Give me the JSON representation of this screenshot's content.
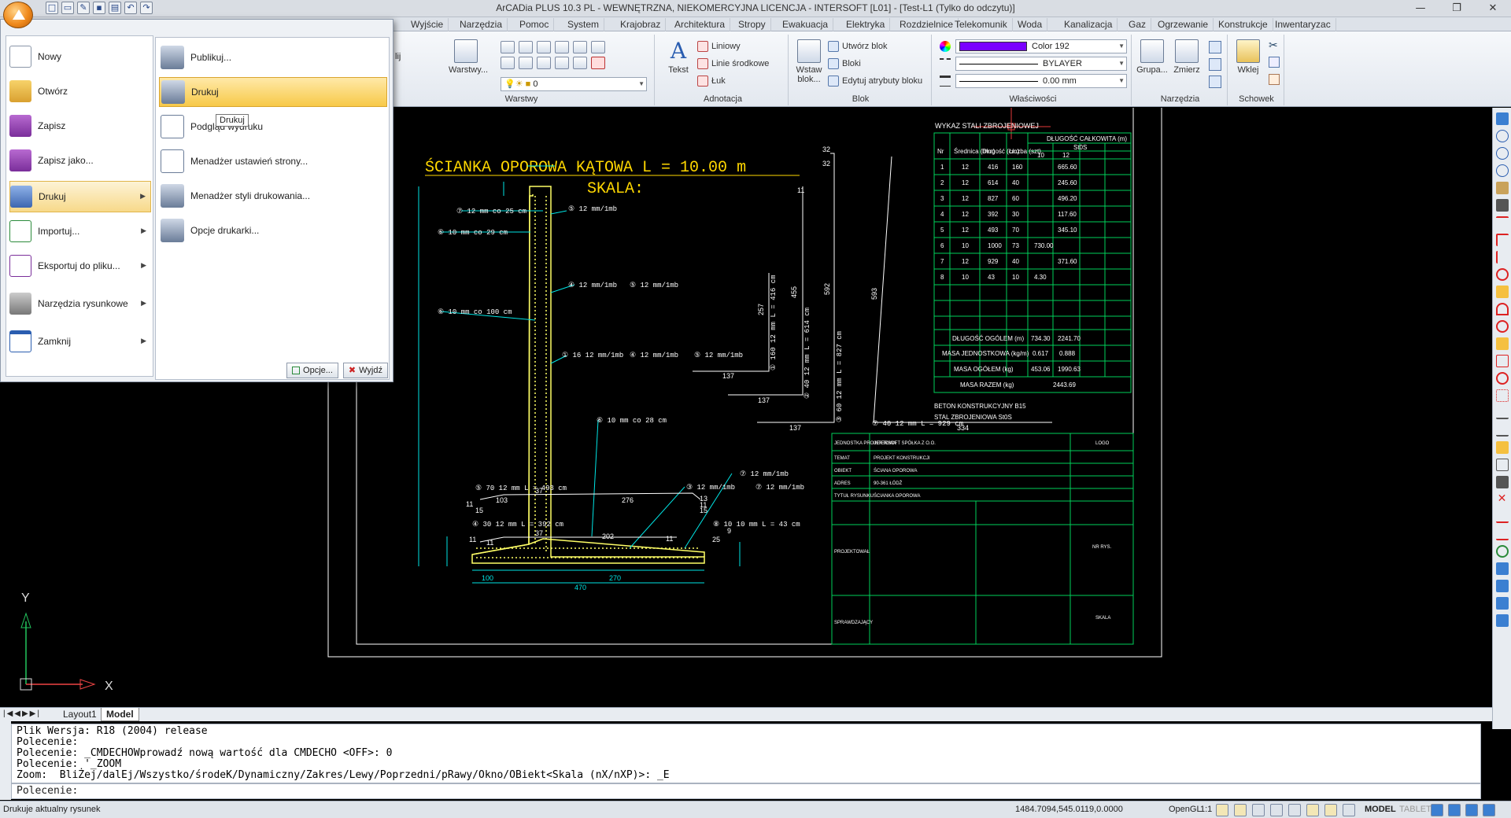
{
  "title": "ArCADia PLUS 10.3 PL - WEWNĘTRZNA, NIEKOMERCYJNA LICENCJA - INTERSOFT [L01] - [Test-L1 (Tylko do odczytu)]",
  "ribbon_tabs": [
    "Wyjście",
    "Narzędzia",
    "Pomoc",
    "System",
    "Krajobraz",
    "Architektura",
    "Stropy",
    "Ewakuacja",
    "Elektryka",
    "Rozdzielnice",
    "Telekomunik",
    "Woda",
    "Kanalizacja",
    "Gaz",
    "Ogrzewanie",
    "Konstrukcje",
    "Inwentaryzac"
  ],
  "ribbon": {
    "layers_label": "Warstwy",
    "layers_btn": "Warstwy...",
    "layer_combo": "0",
    "annotation_label": "Adnotacja",
    "text_btn": "Tekst",
    "linear_btn": "Liniowy",
    "center_lines_btn": "Linie środkowe",
    "arc_btn": "Łuk",
    "block_label": "Blok",
    "insert_block_btn": "Wstaw blok...",
    "create_block_btn": "Utwórz blok",
    "blocks_btn": "Bloki",
    "edit_attr_btn": "Edytuj atrybuty bloku",
    "properties_label": "Właściwości",
    "color_combo": "Color 192",
    "color_value": "#7a00ff",
    "linetype_combo": "BYLAYER",
    "lineweight_combo": "0.00 mm",
    "tools_label": "Narzędzia",
    "group_btn": "Grupa...",
    "measure_btn": "Zmierz",
    "clipboard_label": "Schowek",
    "paste_btn": "Wklej",
    "partial_label": "lij"
  },
  "app_menu": {
    "left_items": [
      {
        "label": "Nowy",
        "icon": "new-file-icon"
      },
      {
        "label": "Otwórz",
        "icon": "open-folder-icon"
      },
      {
        "label": "Zapisz",
        "icon": "save-icon"
      },
      {
        "label": "Zapisz jako...",
        "icon": "save-as-icon"
      },
      {
        "label": "Drukuj",
        "icon": "printer-icon"
      },
      {
        "label": "Importuj...",
        "icon": "import-icon"
      },
      {
        "label": "Eksportuj do pliku...",
        "icon": "export-icon"
      },
      {
        "label": "Narzędzia rysunkowe",
        "icon": "drawing-tools-icon"
      },
      {
        "label": "Zamknij",
        "icon": "close-file-icon"
      }
    ],
    "right_items": [
      {
        "label": "Publikuj...",
        "icon": "publish-icon"
      },
      {
        "label": "Drukuj",
        "icon": "printer-icon"
      },
      {
        "label": "Podgląd wydruku",
        "icon": "print-preview-icon"
      },
      {
        "label": "Menadżer ustawień strony...",
        "icon": "page-setup-icon"
      },
      {
        "label": "Menadżer styli drukowania...",
        "icon": "print-styles-icon"
      },
      {
        "label": "Opcje drukarki...",
        "icon": "printer-options-icon"
      }
    ],
    "tooltip": "Drukuj",
    "options_btn": "Opcje...",
    "exit_btn": "Wyjdź"
  },
  "drawing": {
    "title": "ŚCIANKA OPOROWA KĄTOWA L = 10.00 m",
    "scale": "SKALA:",
    "steel_table_title": "WYKAZ STALI ZBROJENIOWEJ",
    "steel_length_header": "DŁUGOŚĆ CAŁKOWITA (m)",
    "steel_grade": "St0S",
    "steel_cols": [
      "Nr",
      "Średnica (mm)",
      "Długość (cm)",
      "Liczba (szt)",
      "10",
      "12"
    ],
    "steel_rows": [
      [
        "1",
        "12",
        "416",
        "160",
        "",
        "665.60"
      ],
      [
        "2",
        "12",
        "614",
        "40",
        "",
        "245.60"
      ],
      [
        "3",
        "12",
        "827",
        "60",
        "",
        "496.20"
      ],
      [
        "4",
        "12",
        "392",
        "30",
        "",
        "117.60"
      ],
      [
        "5",
        "12",
        "493",
        "70",
        "",
        "345.10"
      ],
      [
        "6",
        "10",
        "1000",
        "73",
        "730.00",
        ""
      ],
      [
        "7",
        "12",
        "929",
        "40",
        "",
        "371.60"
      ],
      [
        "8",
        "10",
        "43",
        "10",
        "4.30",
        ""
      ]
    ],
    "steel_summary": [
      [
        "DŁUGOŚĆ OGÓLEM (m)",
        "734.30",
        "2241.70"
      ],
      [
        "MASA JEDNOSTKOWA (kg/m)",
        "0.617",
        "0.888"
      ],
      [
        "MASA OGÓŁEM (kg)",
        "453.06",
        "1990.63"
      ],
      [
        "MASA RAZEM (kg)",
        "2443.69"
      ]
    ],
    "concrete_note": "BETON KONSTRUKCYJNY B15",
    "steel_note": "STAL ZBROJENIOWA St0S",
    "labels": [
      "⑦ 12 mm co 25 cm",
      "⑤ 12 mm/1mb",
      "⑥ 10 mm co 29 cm",
      "④ 12 mm/1mb",
      "⑤ 12 mm/1mb",
      "⑥ 10 mm co 100 cm",
      "① 16 12 mm/1mb",
      "④ 12 mm/1mb",
      "⑤ 12 mm/1mb",
      "⑥ 10 mm co 28 cm",
      "⑦ 12 mm/1mb",
      "③ 12 mm/1mb",
      "⑦ 12 mm/1mb",
      "⑤ 70 12 mm  L = 493 cm",
      "④ 30 12 mm  L = 392 cm",
      "⑧ 10 10 mm  L = 43 cm",
      "⑦ 40 12 mm  L = 929 cm",
      "① 160 12 mm  L = 416 cm",
      "② 40 12 mm  L = 614 cm",
      "③ 60 12 mm  L = 827 cm"
    ],
    "dims": [
      "32",
      "32",
      "11",
      "257",
      "455",
      "592",
      "593",
      "137",
      "137",
      "137",
      "334",
      "103",
      "276",
      "37",
      "202",
      "37",
      "11",
      "11",
      "15",
      "11",
      "11",
      "13",
      "15",
      "100",
      "270",
      "470",
      "11",
      "9",
      "25"
    ],
    "title_block": {
      "rows": [
        "JEDNOSTKA PROJEKTOWA",
        "TEMAT",
        "OBIEKT",
        "ADRES",
        "TYTUŁ RYSUNKU",
        "PROJEKTOWAŁ",
        "SPRAWDZAJĄCY"
      ],
      "values": [
        "INTERSOFT SPÓŁKA Z O.O.",
        "PROJEKT KONSTRUKCJI",
        "ŚCIANA OPOROWA",
        "90-361 ŁÓDŹ",
        "ŚCIANKA OPOROWA",
        "",
        ""
      ],
      "right": [
        "LOGO",
        "NR RYS.",
        "SKALA"
      ]
    }
  },
  "layout_tabs": [
    "Layout1",
    "Model"
  ],
  "command_history": [
    "Plik Wersja: R18 (2004) release",
    "Polecenie:",
    "Polecenie: _CMDECHOWprowadź nową wartość dla CMDECHO <OFF>: 0",
    "Polecenie: '_ZOOM",
    "Zoom:  BliŻej/dalEj/Wszystko/środeK/Dynamiczny/Zakres/Lewy/Poprzedni/pRawy/Okno/OBiekt<Skala (nX/nXP)>: _E"
  ],
  "command_prompt": "Polecenie:",
  "status": {
    "message": "Drukuje aktualny rysunek",
    "coords": "1484.7094,545.0119,0.0000",
    "opengl": "OpenGL",
    "scale": "1:1",
    "model": "MODEL",
    "tablet": "TABLET"
  },
  "ucs": {
    "x": "X",
    "y": "Y"
  }
}
